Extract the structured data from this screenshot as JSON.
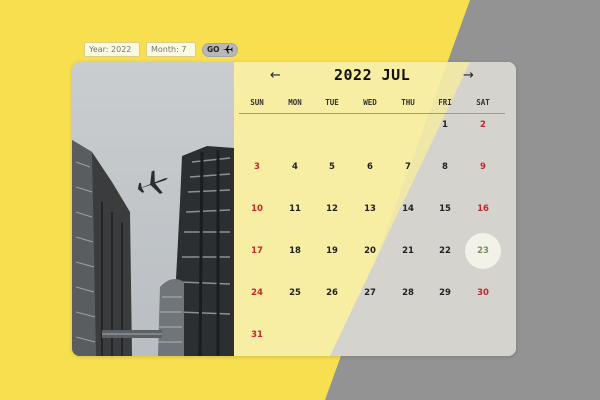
{
  "controls": {
    "year_placeholder": "Year: 2022",
    "month_placeholder": "Month: 7",
    "go_label": "GO"
  },
  "calendar": {
    "title": "2022 JUL",
    "prev_icon": "arrow-left-icon",
    "next_icon": "arrow-right-icon",
    "weekdays": [
      "SUN",
      "MON",
      "TUE",
      "WED",
      "THU",
      "FRI",
      "SAT"
    ],
    "today": "23",
    "weeks": [
      [
        "",
        "",
        "",
        "",
        "",
        "1",
        "2"
      ],
      [
        "3",
        "4",
        "5",
        "6",
        "7",
        "8",
        "9"
      ],
      [
        "10",
        "11",
        "12",
        "13",
        "14",
        "15",
        "16"
      ],
      [
        "17",
        "18",
        "19",
        "20",
        "21",
        "22",
        "23"
      ],
      [
        "24",
        "25",
        "26",
        "27",
        "28",
        "29",
        "30"
      ],
      [
        "31",
        "",
        "",
        "",
        "",
        "",
        ""
      ]
    ]
  },
  "colors": {
    "background_yellow": "#f7df4f",
    "background_gray": "#939393",
    "weekend_red": "#c1272d"
  }
}
